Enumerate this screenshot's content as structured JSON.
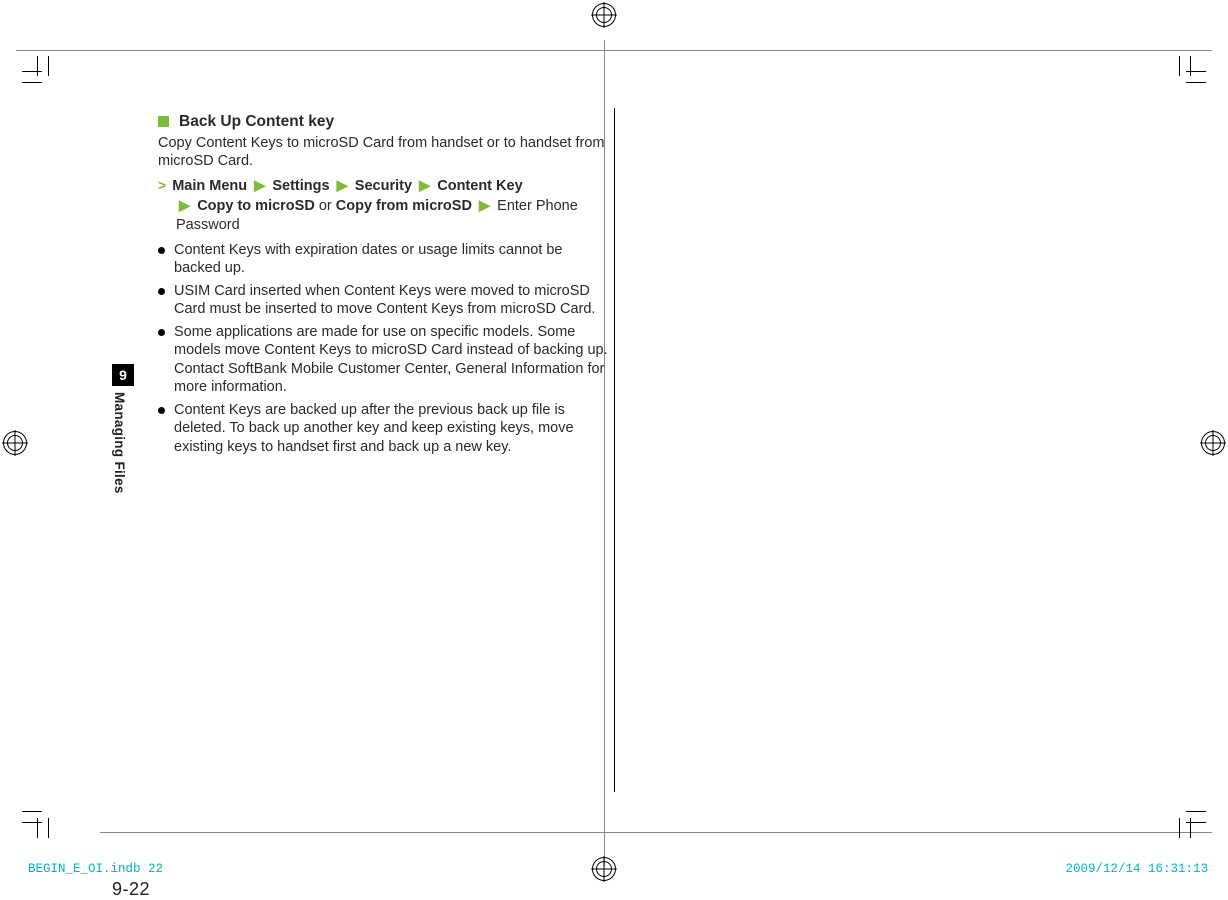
{
  "chapter": {
    "number": "9",
    "title": "Managing Files"
  },
  "section": {
    "title": "Back Up Content key"
  },
  "intro": "Copy Content Keys to microSD Card from handset or to handset from microSD Card.",
  "nav": {
    "main_menu": "Main Menu",
    "settings": "Settings",
    "security": "Security",
    "content_key": "Content Key",
    "copy_to": "Copy to microSD",
    "or": " or ",
    "copy_from": "Copy from microSD",
    "tail": " Enter Phone Password"
  },
  "bullets": [
    "Content Keys with expiration dates or usage limits cannot be backed up.",
    "USIM Card inserted when Content Keys were moved to microSD Card must be inserted to move Content Keys from microSD Card.",
    "Some applications are made for use on specific models. Some models move Content Keys to microSD Card instead of backing up. Contact SoftBank Mobile Customer Center, General Information for more information.",
    "Content Keys are backed up after the previous back up file is deleted. To back up another key and keep existing keys, move existing keys to handset first and back up a new key."
  ],
  "page_number": "9-22",
  "slug": {
    "file": "BEGIN_E_OI.indb   22",
    "stamp": "2009/12/14   16:31:13"
  }
}
